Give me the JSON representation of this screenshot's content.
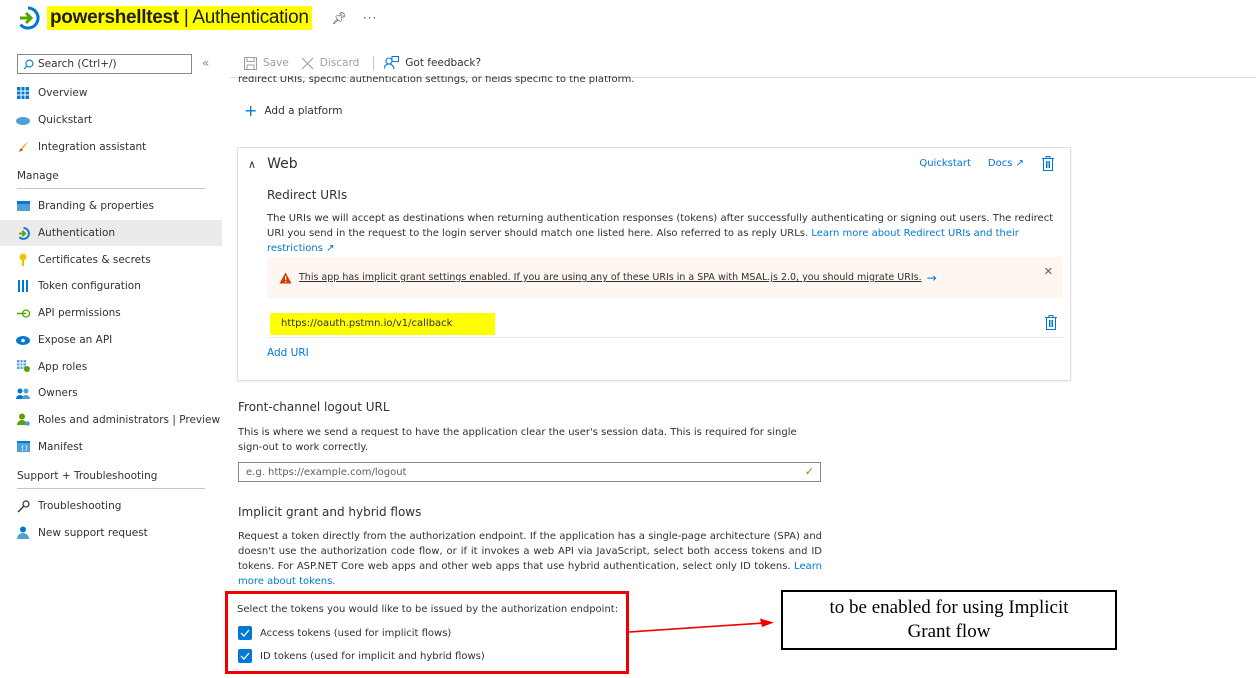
{
  "header": {
    "app_name": "powershelltest",
    "separator": " | ",
    "page_name": "Authentication",
    "pin_icon": "pin-icon",
    "more_icon": "ellipsis-icon"
  },
  "sidebar": {
    "search_placeholder": "Search (Ctrl+/)",
    "collapse_icon": "double-chevron-left-icon",
    "top_items": [
      {
        "label": "Overview",
        "icon": "grid-icon"
      },
      {
        "label": "Quickstart",
        "icon": "cloud-icon"
      },
      {
        "label": "Integration assistant",
        "icon": "rocket-icon"
      }
    ],
    "manage_section": "Manage",
    "manage_items": [
      {
        "label": "Branding & properties",
        "icon": "card-icon"
      },
      {
        "label": "Authentication",
        "icon": "auth-arrow-icon",
        "active": true
      },
      {
        "label": "Certificates & secrets",
        "icon": "key-icon"
      },
      {
        "label": "Token configuration",
        "icon": "bars-icon"
      },
      {
        "label": "API permissions",
        "icon": "api-arrow-icon"
      },
      {
        "label": "Expose an API",
        "icon": "cloud-api-icon"
      },
      {
        "label": "App roles",
        "icon": "app-roles-icon"
      },
      {
        "label": "Owners",
        "icon": "users-icon"
      },
      {
        "label": "Roles and administrators | Preview",
        "icon": "admin-icon"
      },
      {
        "label": "Manifest",
        "icon": "manifest-icon"
      }
    ],
    "support_section": "Support + Troubleshooting",
    "support_items": [
      {
        "label": "Troubleshooting",
        "icon": "wrench-icon"
      },
      {
        "label": "New support request",
        "icon": "support-person-icon"
      }
    ]
  },
  "toolbar": {
    "save_label": "Save",
    "discard_label": "Discard",
    "feedback_label": "Got feedback?"
  },
  "main": {
    "cut_off_text": "redirect URIs, specific authentication settings, or fields specific to the platform.",
    "add_platform_label": "Add a platform",
    "web_card": {
      "title": "Web",
      "quickstart_link": "Quickstart",
      "docs_link": "Docs",
      "redirect_title": "Redirect URIs",
      "redirect_desc": "The URIs we will accept as destinations when returning authentication responses (tokens) after successfully authenticating or signing out users. The redirect URI you send in the request to the login server should match one listed here. Also referred to as reply URLs. ",
      "redirect_link": "Learn more about Redirect URIs and their restrictions",
      "warning_text": "This app has implicit grant settings enabled. If you are using any of these URIs in a SPA with MSAL.js 2.0, you should migrate URIs.",
      "redirect_uris": [
        "https://oauth.pstmn.io/v1/callback"
      ],
      "add_uri_label": "Add URI"
    },
    "front_channel": {
      "title": "Front-channel logout URL",
      "desc": "This is where we send a request to have the application clear the user's session data. This is required for single sign-out to work correctly.",
      "input_value": "",
      "input_placeholder": "e.g. https://example.com/logout"
    },
    "implicit": {
      "title": "Implicit grant and hybrid flows",
      "desc": "Request a token directly from the authorization endpoint. If the application has a single-page architecture (SPA) and doesn't use the authorization code flow, or if it invokes a web API via JavaScript, select both access tokens and ID tokens. For ASP.NET Core web apps and other web apps that use hybrid authentication, select only ID tokens. ",
      "link": "Learn more about tokens.",
      "select_label": "Select the tokens you would like to be issued by the authorization endpoint:",
      "tokens": [
        {
          "label": "Access tokens (used for implicit flows)",
          "checked": true
        },
        {
          "label": "ID tokens (used for implicit and hybrid flows)",
          "checked": true
        }
      ]
    }
  },
  "annotation": {
    "text_line1": "to be enabled for using Implicit",
    "text_line2": "Grant flow",
    "highlight_color": "#ffff00",
    "box_color": "#f20000"
  },
  "colors": {
    "accent": "#0078d4",
    "warning_bg": "#fdf6f1",
    "warning_icon": "#d83b01",
    "success": "#57a300"
  }
}
